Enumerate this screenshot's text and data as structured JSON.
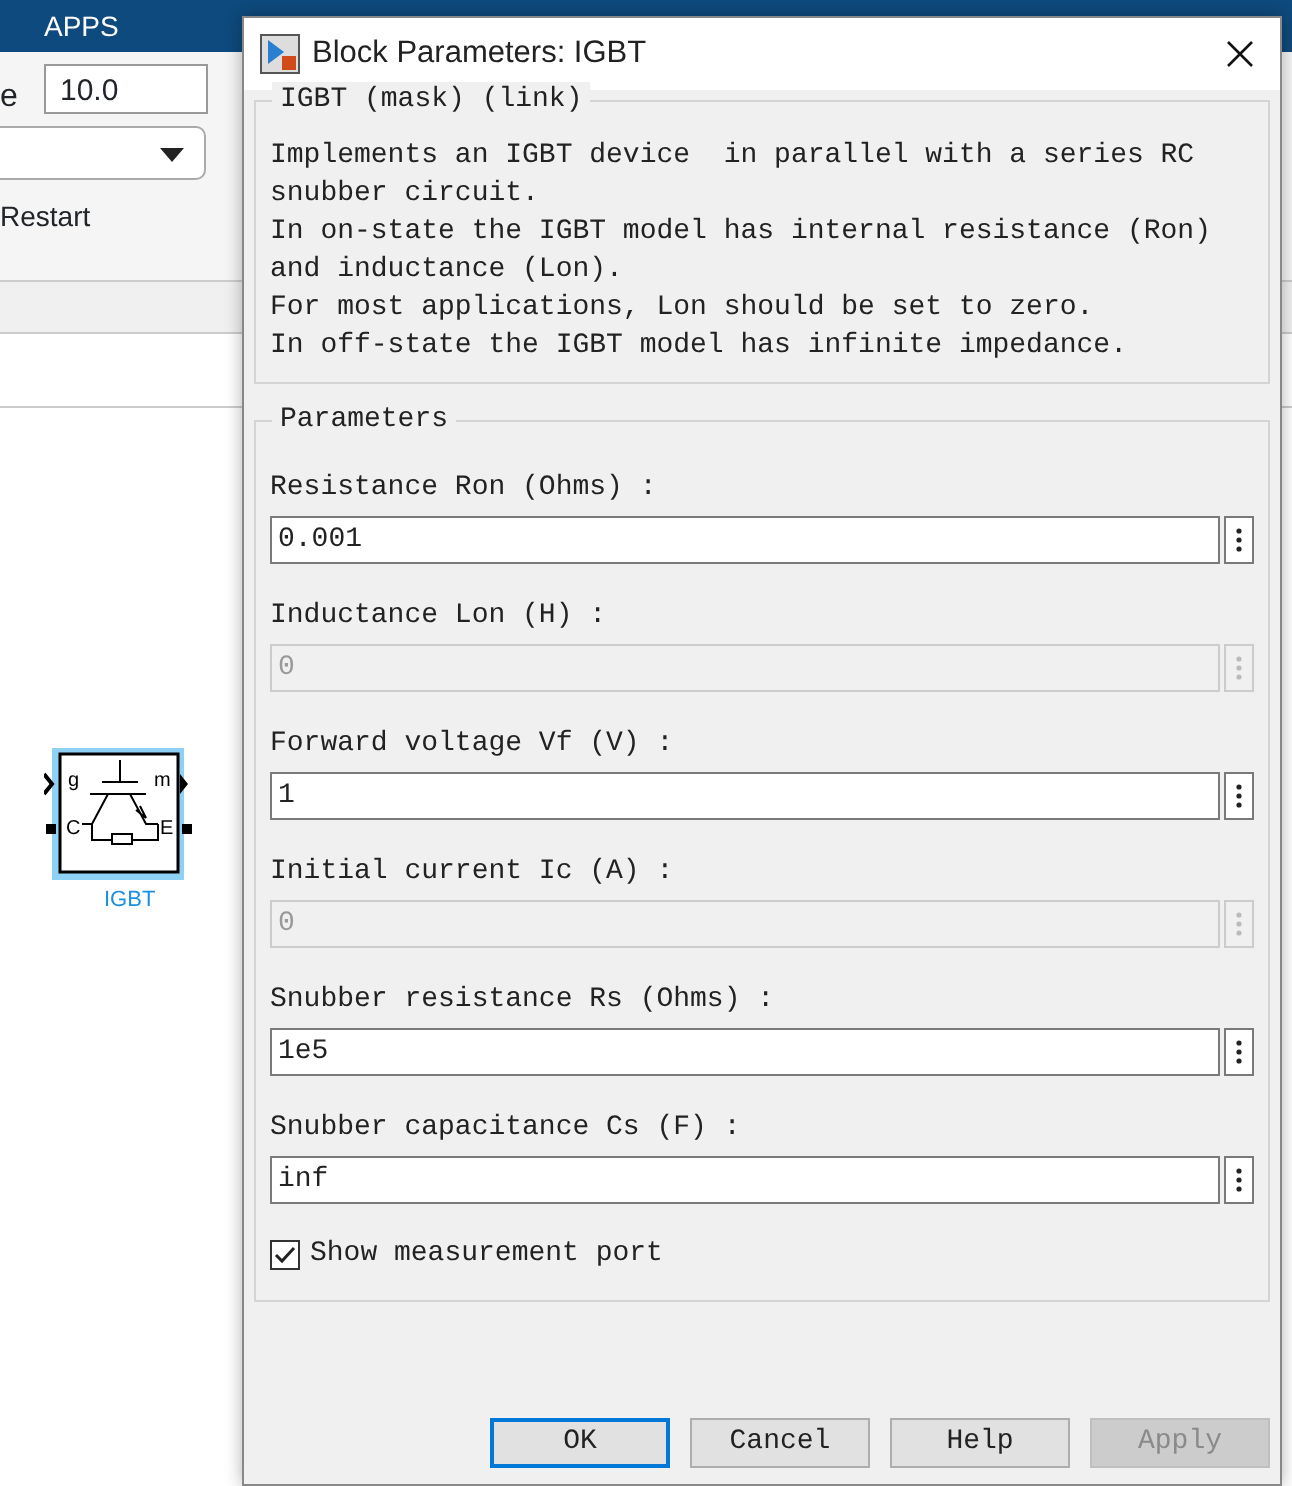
{
  "app": {
    "tab": "APPS",
    "toolbar": {
      "field_label": "e",
      "field_value": "10.0",
      "restart_label": "Restart"
    },
    "block": {
      "name": "IGBT",
      "selected": true,
      "ports": [
        "g",
        "m",
        "C",
        "E"
      ]
    }
  },
  "dialog": {
    "title": "Block Parameters: IGBT",
    "mask_group": {
      "title": "IGBT (mask) (link)",
      "description": "Implements an IGBT device  in parallel with a series RC\nsnubber circuit.\nIn on-state the IGBT model has internal resistance (Ron)\nand inductance (Lon).\nFor most applications, Lon should be set to zero.\nIn off-state the IGBT model has infinite impedance."
    },
    "params_group": {
      "title": "Parameters",
      "fields": [
        {
          "label": "Resistance Ron (Ohms) :",
          "value": "0.001",
          "disabled": false
        },
        {
          "label": "Inductance Lon (H) :",
          "value": "0",
          "disabled": true
        },
        {
          "label": "Forward voltage Vf (V) :",
          "value": "1",
          "disabled": false
        },
        {
          "label": "Initial current Ic (A) :",
          "value": "0",
          "disabled": true
        },
        {
          "label": "Snubber resistance Rs (Ohms) :",
          "value": "1e5",
          "disabled": false
        },
        {
          "label": "Snubber capacitance Cs (F) :",
          "value": "inf",
          "disabled": false
        }
      ],
      "checkbox": {
        "label": "Show measurement port",
        "checked": true
      }
    },
    "buttons": [
      {
        "label": "OK",
        "default": true,
        "disabled": false
      },
      {
        "label": "Cancel",
        "default": false,
        "disabled": false
      },
      {
        "label": "Help",
        "default": false,
        "disabled": false
      },
      {
        "label": "Apply",
        "default": false,
        "disabled": true
      }
    ]
  }
}
